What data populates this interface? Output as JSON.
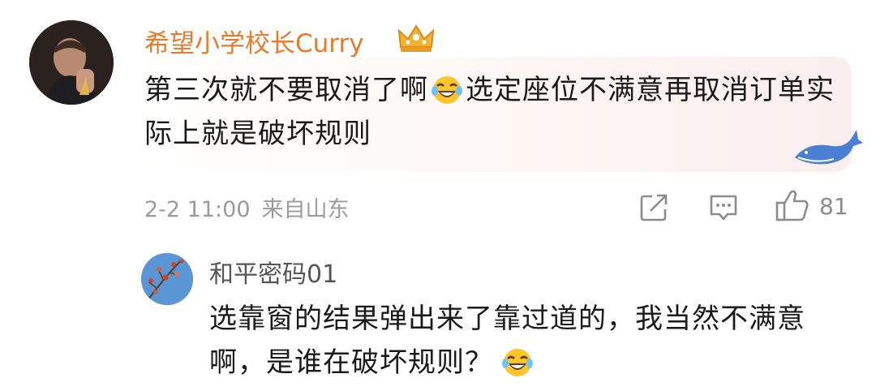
{
  "comment": {
    "username": "希望小学校长Curry",
    "text_part1": "第三次就不要取消了啊",
    "text_part2": "选定座位不满意再取消订单实际上就是破坏规则",
    "date": "2-2 11:00",
    "location": "来自山东",
    "like_count": "81",
    "badge_icon": "crown-icon",
    "inline_emoji": "laugh-cry-emoji",
    "username_color": "#ea7a2b"
  },
  "reply": {
    "username": "和平密码01",
    "text": "选靠窗的结果弹出来了靠过道的，我当然不满意啊，是谁在破坏规则？",
    "inline_emoji": "laugh-cry-emoji"
  }
}
